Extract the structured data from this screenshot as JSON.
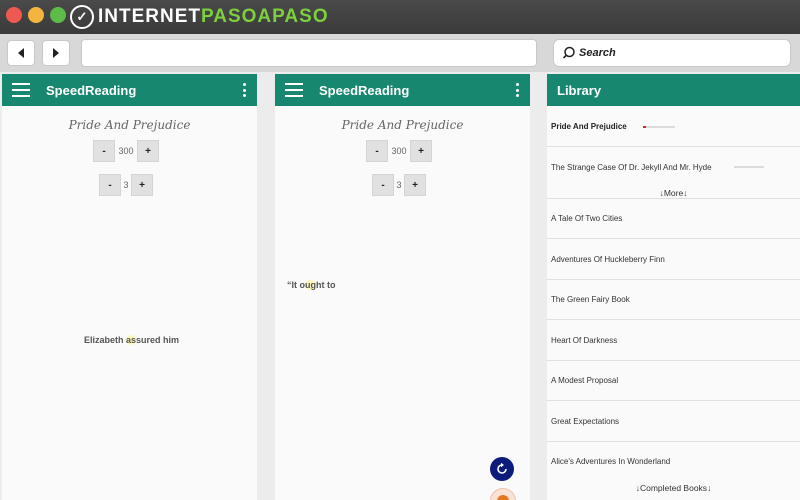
{
  "window": {
    "brand": {
      "prefix": "INTERNET",
      "accent": "PASOAPASO"
    }
  },
  "browser": {
    "back_icon": "back-arrow-icon",
    "forward_icon": "forward-arrow-icon",
    "url": "",
    "search_placeholder": "Search"
  },
  "reader1": {
    "app_title": "SpeedReading",
    "book_title": "Pride And Prejudice",
    "wpm": {
      "minus": "-",
      "value": "300",
      "plus": "+"
    },
    "words": {
      "minus": "-",
      "value": "3",
      "plus": "+"
    },
    "text_before": "Elizabeth ",
    "text_focus": "as",
    "text_after": "sured him"
  },
  "reader2": {
    "app_title": "SpeedReading",
    "book_title": "Pride And Prejudice",
    "wpm": {
      "minus": "-",
      "value": "300",
      "plus": "+"
    },
    "words": {
      "minus": "-",
      "value": "3",
      "plus": "+"
    },
    "text_before": "“It o",
    "text_focus": "ug",
    "text_after": "ht to"
  },
  "library": {
    "title": "Library",
    "books": [
      {
        "title": "Pride And Prejudice",
        "progress": 0.1
      },
      {
        "title": "The Strange Case Of Dr. Jekyll And Mr. Hyde",
        "progress": 0.0
      }
    ],
    "more_label": "↓More↓",
    "catalog": [
      "A Tale Of Two Cities",
      "Adventures Of Huckleberry Finn",
      "The Green Fairy Book",
      "Heart Of Darkness",
      "A Modest Proposal",
      "Great Expectations",
      "Alice's Adventures In Wonderland"
    ],
    "completed_label": "↓Completed Books↓"
  },
  "colors": {
    "appbar": "#17876f",
    "fab": "#0d1b7a",
    "progress": "#d92626"
  }
}
